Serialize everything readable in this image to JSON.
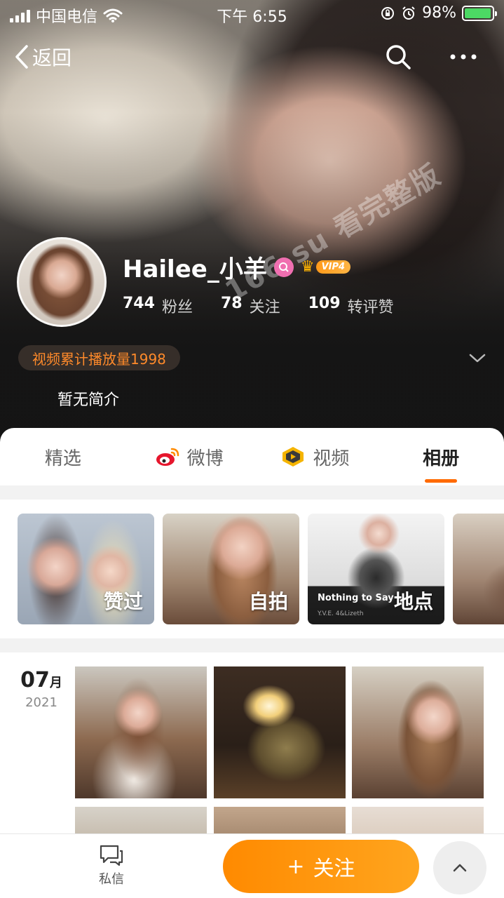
{
  "status_bar": {
    "carrier": "中国电信",
    "time": "下午 6:55",
    "battery_percent": "98%",
    "battery_level": 0.98
  },
  "nav": {
    "back_label": "返回"
  },
  "watermark": "166.su 看完整版",
  "profile": {
    "name": "Hailee_小羊",
    "vip_label": "VIP4",
    "stats": [
      {
        "num": "744",
        "label": "粉丝"
      },
      {
        "num": "78",
        "label": "关注"
      },
      {
        "num": "109",
        "label": "转评赞"
      }
    ],
    "video_plays": "视频累计播放量1998",
    "bio": "暂无简介"
  },
  "tabs": [
    {
      "label": "精选"
    },
    {
      "label": "微博"
    },
    {
      "label": "视频"
    },
    {
      "label": "相册"
    }
  ],
  "active_tab": "相册",
  "albums": [
    {
      "label": "赞过"
    },
    {
      "label": "自拍"
    },
    {
      "label": "地点",
      "caption": "Nothing to Say",
      "sub_caption": "Y.V.E. 4&Lizeth"
    },
    {
      "label": ""
    }
  ],
  "timeline": {
    "month": "07",
    "month_unit": "月",
    "year": "2021"
  },
  "bottom_bar": {
    "dm_label": "私信",
    "follow_label": "关注",
    "follow_plus": "+"
  },
  "colors": {
    "accent": "#ff8a00",
    "tab_underline": "#ff6a00",
    "video_pill_text": "#ff8a2a",
    "gender_badge": "#f06fb0",
    "battery_fill": "#4cd964"
  }
}
